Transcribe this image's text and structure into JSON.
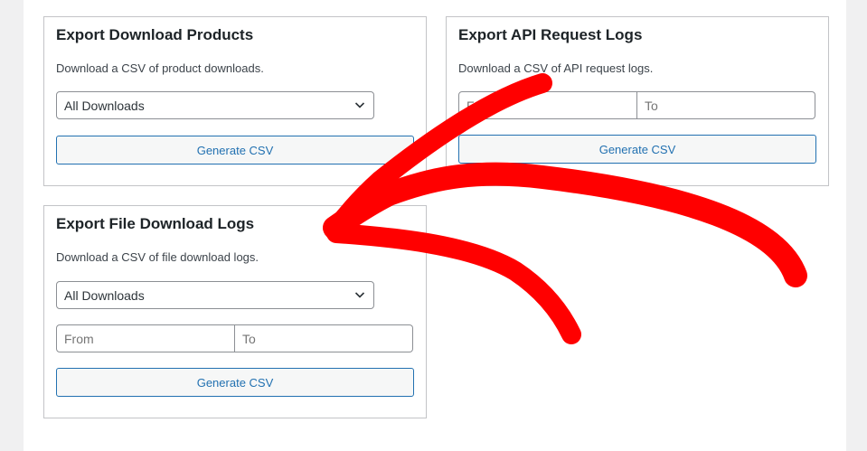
{
  "cards": {
    "products": {
      "title": "Export Download Products",
      "description": "Download a CSV of product downloads.",
      "select_value": "All Downloads",
      "button_label": "Generate CSV"
    },
    "api_logs": {
      "title": "Export API Request Logs",
      "description": "Download a CSV of API request logs.",
      "from_placeholder": "From",
      "to_placeholder": "To",
      "button_label": "Generate CSV"
    },
    "file_logs": {
      "title": "Export File Download Logs",
      "description": "Download a CSV of file download logs.",
      "select_value": "All Downloads",
      "from_placeholder": "From",
      "to_placeholder": "To",
      "button_label": "Generate CSV"
    }
  },
  "annotation": {
    "type": "hand-drawn-arrow",
    "color": "#ff0000",
    "direction": "points-left"
  }
}
